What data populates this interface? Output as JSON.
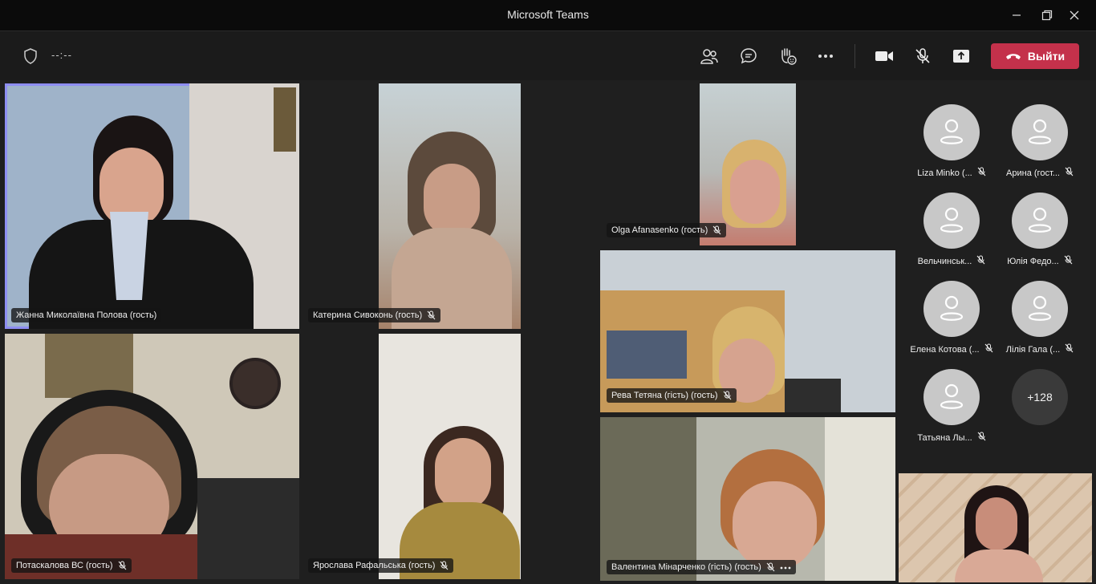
{
  "window": {
    "title": "Microsoft Teams"
  },
  "toolbar": {
    "timer": "--:--",
    "leave_label": "Выйти",
    "icons": [
      "shield-icon",
      "participants-icon",
      "chat-icon",
      "raise-hand-icon",
      "more-icon",
      "camera-icon",
      "mic-off-icon",
      "share-screen-icon",
      "phone-icon"
    ]
  },
  "tiles": [
    {
      "name": "Жанна Миколаївна Полова (гость)"
    },
    {
      "name": "Катерина Сивоконь (гость)"
    },
    {
      "name": "Olga Afanasenko (гость)"
    },
    {
      "name": "Рева Тетяна (гість) (гость)"
    },
    {
      "name": "Потаскалова ВС (гость)"
    },
    {
      "name": "Ярослава Рафальська (гость)"
    },
    {
      "name": "Валентина Мінарченко (гість) (гость)"
    }
  ],
  "roster": [
    {
      "name": "Liza Minko (..."
    },
    {
      "name": "Арина (гост..."
    },
    {
      "name": "Вельчинськ..."
    },
    {
      "name": "Юлія Федо..."
    },
    {
      "name": "Елена Котова (..."
    },
    {
      "name": "Лілія Гала (..."
    },
    {
      "name": "Татьяна Лы..."
    }
  ],
  "overflow_count": "+128",
  "colors": {
    "accent": "#8e8ef2",
    "leave": "#c4314b",
    "background": "#1f1f1f"
  }
}
